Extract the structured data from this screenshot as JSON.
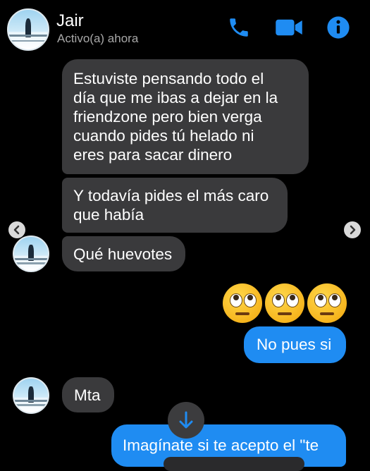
{
  "header": {
    "name": "Jair",
    "status": "Activo(a) ahora",
    "accent_color": "#1f8cf2",
    "icons": [
      "phone-icon",
      "video-camera-icon",
      "info-icon"
    ]
  },
  "messages": {
    "m1": [
      "Estuviste pensando todo el",
      "día que me ibas a dejar en la",
      "friendzone pero bien verga",
      "cuando pides tú helado ni",
      "eres para sacar dinero"
    ],
    "m2": [
      "Y todavía pides el más caro",
      "que había"
    ],
    "m3": "Qué huevotes",
    "emojis": [
      "face-with-rolling-eyes",
      "face-with-rolling-eyes",
      "face-with-rolling-eyes"
    ],
    "m4": "No pues si",
    "m5": "Mta",
    "m6": "Imagínate si te acepto el \"te"
  },
  "colors": {
    "incoming_bubble": "#3a3a3c",
    "outgoing_bubble": "#1f8cf2",
    "background": "#000000"
  }
}
